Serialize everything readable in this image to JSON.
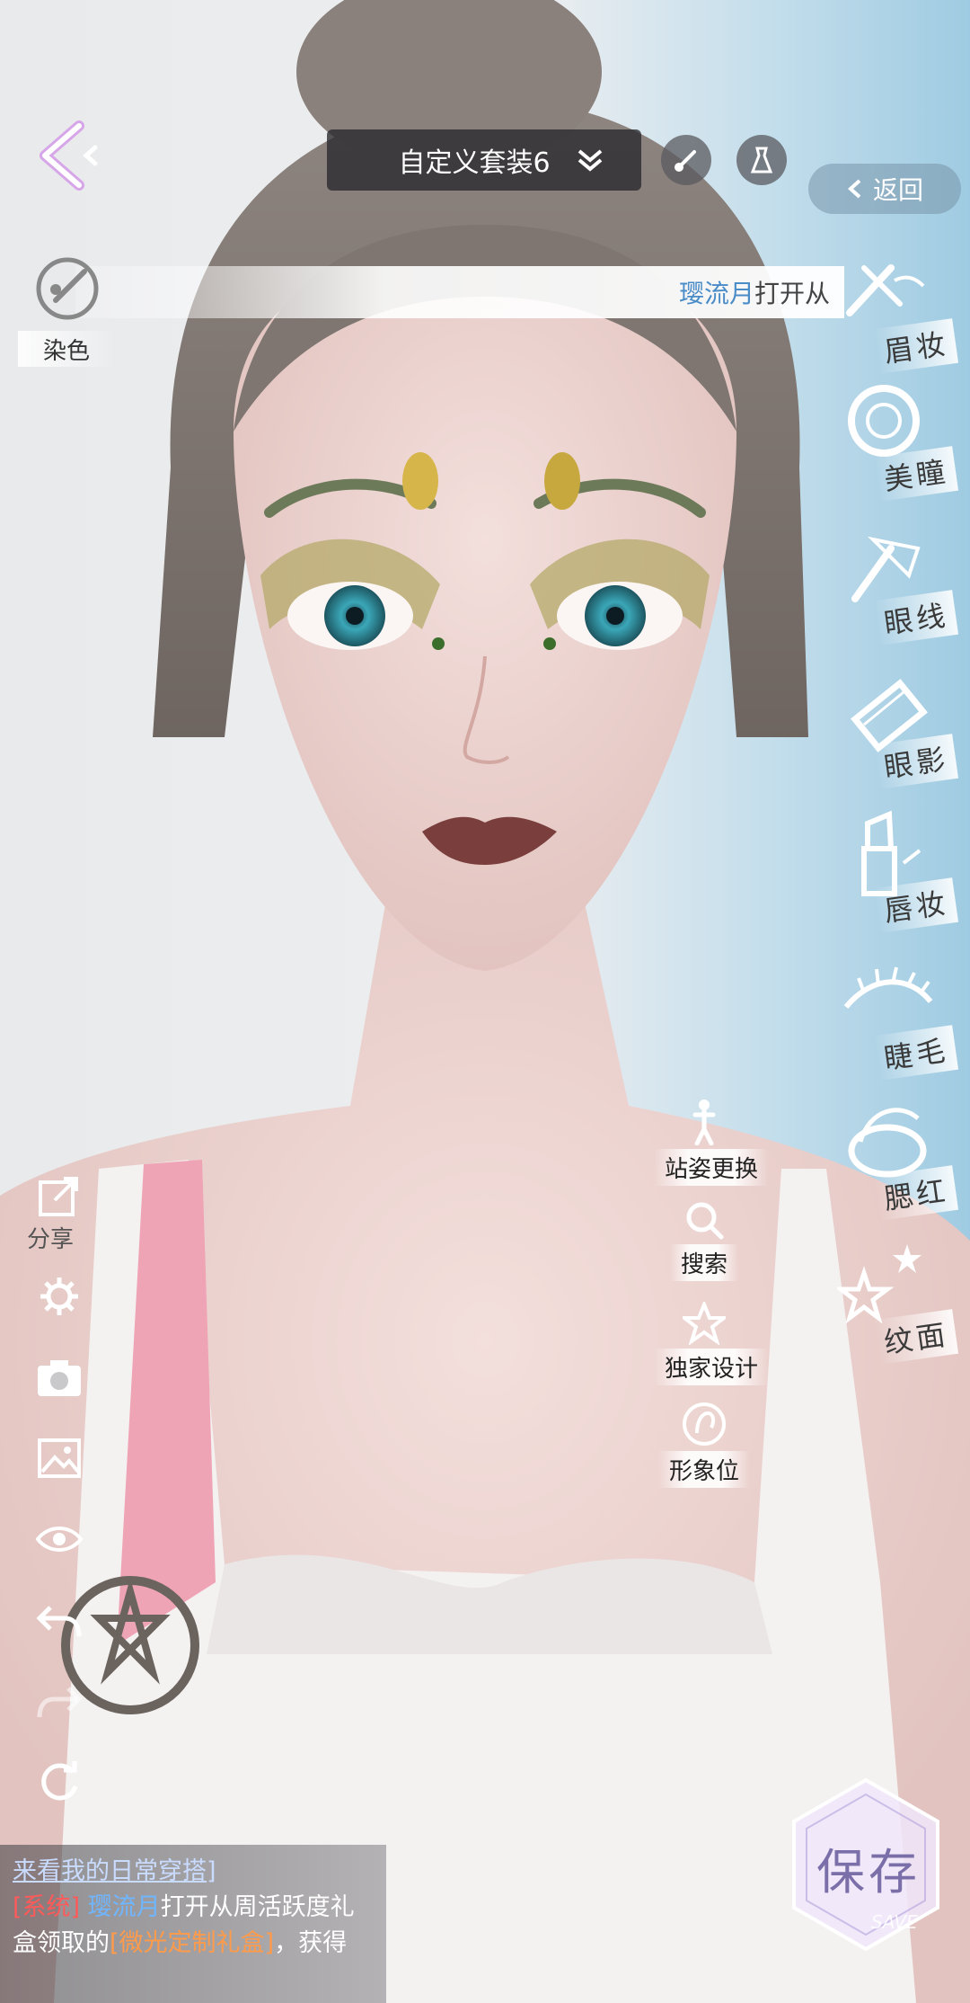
{
  "header": {
    "outfit_name": "自定义套装6",
    "return_label": "返回"
  },
  "notice": {
    "user": "璎流月",
    "text": "打开从"
  },
  "dye": {
    "label": "染色"
  },
  "categories": [
    {
      "label": "眉妆",
      "icon": "brow-icon"
    },
    {
      "label": "美瞳",
      "icon": "contact-lens-icon"
    },
    {
      "label": "眼线",
      "icon": "eyeliner-icon"
    },
    {
      "label": "眼影",
      "icon": "eyeshadow-palette-icon"
    },
    {
      "label": "唇妆",
      "icon": "lipstick-icon"
    },
    {
      "label": "睫毛",
      "icon": "eyelash-icon"
    },
    {
      "label": "腮红",
      "icon": "blush-compact-icon"
    },
    {
      "label": "纹面",
      "icon": "stars-icon"
    }
  ],
  "actions": [
    {
      "label": "站姿更换",
      "icon": "stance-icon"
    },
    {
      "label": "搜索",
      "icon": "search-icon"
    },
    {
      "label": "独家设计",
      "icon": "star-icon"
    },
    {
      "label": "形象位",
      "icon": "avatar-icon"
    }
  ],
  "tools": {
    "share_label": "分享"
  },
  "chat": {
    "line1": "来看我的日常穿搭]",
    "sys_tag": "[系统]",
    "user": "璎流月",
    "text_a": "打开从周活跃度礼盒领取的",
    "gift": "[微光定制礼盒]",
    "text_b": "，获得"
  },
  "save": {
    "label": "保存",
    "sub": "SAVE"
  }
}
